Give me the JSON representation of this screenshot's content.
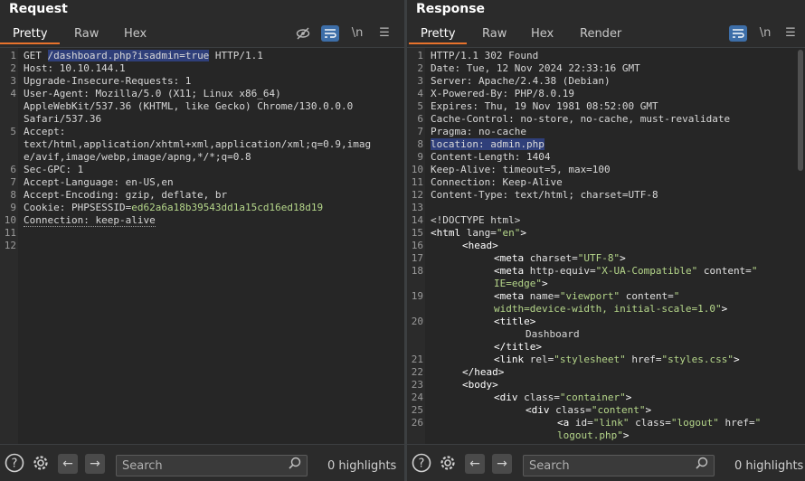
{
  "request": {
    "title": "Request",
    "tabs": [
      "Pretty",
      "Raw",
      "Hex"
    ],
    "newline_label": "\\n",
    "line_numbers": [
      "1",
      "2",
      "3",
      "4",
      "5",
      "6",
      "7",
      "8",
      "9",
      "10",
      "11",
      "12"
    ],
    "lines": {
      "l1_method": "GET ",
      "l1_path": "/dashboard.php?isadmin=true",
      "l1_proto": " HTTP/1.1",
      "l2": "Host: 10.10.144.1",
      "l3": "Upgrade-Insecure-Requests: 1",
      "l4a": "User-Agent: Mozilla/5.0 (X11; Linux x86_64)",
      "l4b": "AppleWebKit/537.36 (KHTML, like Gecko) Chrome/130.0.0.0",
      "l4c": "Safari/537.36",
      "l5a": "Accept:",
      "l5b": "text/html,application/xhtml+xml,application/xml;q=0.9,imag",
      "l5c": "e/avif,image/webp,image/apng,*/*;q=0.8",
      "l6": "Sec-GPC: 1",
      "l7": "Accept-Language: en-US,en",
      "l8": "Accept-Encoding: gzip, deflate, br",
      "l9_key": "Cookie: PHPSESSID=",
      "l9_val": "ed62a6a18b39543dd1a15cd16ed18d19",
      "l10": "Connection: keep-alive"
    },
    "search_placeholder": "Search",
    "highlights": "0 highlights"
  },
  "response": {
    "title": "Response",
    "tabs": [
      "Pretty",
      "Raw",
      "Hex",
      "Render"
    ],
    "newline_label": "\\n",
    "line_numbers": [
      "1",
      "2",
      "3",
      "4",
      "5",
      "6",
      "7",
      "8",
      "9",
      "10",
      "11",
      "12",
      "13",
      "14",
      "15",
      "16",
      "17",
      "18",
      "19",
      "20",
      "21",
      "22",
      "23",
      "24",
      "25",
      "26"
    ],
    "headers": {
      "l1": "HTTP/1.1 302 Found",
      "l2": "Date: Tue, 12 Nov 2024 22:33:16 GMT",
      "l3": "Server: Apache/2.4.38 (Debian)",
      "l4": "X-Powered-By: PHP/8.0.19",
      "l5": "Expires: Thu, 19 Nov 1981 08:52:00 GMT",
      "l6": "Cache-Control: no-store, no-cache, must-revalidate",
      "l7": "Pragma: no-cache",
      "l8": "location: admin.php",
      "l9": "Content-Length: 1404",
      "l10": "Keep-Alive: timeout=5, max=100",
      "l11": "Connection: Keep-Alive",
      "l12": "Content-Type: text/html; charset=UTF-8"
    },
    "html": {
      "doctype": "<!DOCTYPE html>",
      "html_open": "<html",
      "lang_attr": " lang=",
      "lang_val": "\"en\"",
      "close": ">",
      "head_open": "<head>",
      "meta": "<meta",
      "charset_attr": " charset=",
      "charset_val": "\"UTF-8\"",
      "http_equiv_attr": " http-equiv=",
      "http_equiv_val": "\"X-UA-Compatible\"",
      "content_attr": " content=",
      "content_val_a": "\"",
      "content_val_b": "IE=edge\"",
      "name_attr": " name=",
      "name_val": "\"viewport\"",
      "content_val2_a": "\"",
      "content_val2_b": "width=device-width, initial-scale=1.0\"",
      "title_open": "<title>",
      "title_text": "Dashboard",
      "title_close": "</title>",
      "link": "<link",
      "rel_attr": " rel=",
      "rel_val": "\"stylesheet\"",
      "href_attr": " href=",
      "href_val": "\"styles.css\"",
      "close_self": ">",
      "head_close": "</head>",
      "body_open": "<body>",
      "div": "<div",
      "class_attr": " class=",
      "container_val": "\"container\"",
      "content_cls_val": "\"content\"",
      "a": "<a",
      "id_attr": " id=",
      "id_val": "\"link\"",
      "logout_val": "\"logout\"",
      "href_val2_a": "\"",
      "href_val2_b": "logout.php\"",
      "gt": ">"
    },
    "search_placeholder": "Search",
    "highlights": "0 highlights"
  }
}
